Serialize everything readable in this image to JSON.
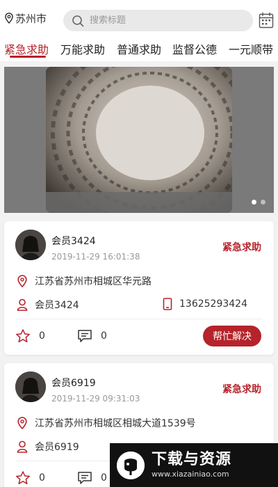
{
  "header": {
    "city": "苏州市",
    "search_placeholder": "搜索标题",
    "icons": {
      "location": "location-icon",
      "search": "search-icon",
      "calendar": "calendar-icon"
    }
  },
  "tabs": [
    {
      "label": "紧急求助",
      "active": true
    },
    {
      "label": "万能求助",
      "active": false
    },
    {
      "label": "普通求助",
      "active": false
    },
    {
      "label": "监督公德",
      "active": false
    },
    {
      "label": "一元顺带",
      "active": false
    }
  ],
  "banner": {
    "pages": 2,
    "current": 1
  },
  "posts": [
    {
      "member": "会员3424",
      "time": "2019-11-29 16:01:38",
      "badge": "紧急求助",
      "address": "江苏省苏州市相城区华元路",
      "contact": "会员3424",
      "phone": "13625293424",
      "likes": "0",
      "comments": "0",
      "action": "帮忙解决"
    },
    {
      "member": "会员6919",
      "time": "2019-11-29 09:31:03",
      "badge": "紧急求助",
      "address": "江苏省苏州市相城区相城大道1539号",
      "contact": "会员6919",
      "likes": "0",
      "comments": "0"
    }
  ],
  "watermark": {
    "title": "下载与资源",
    "url": "www.xiazainiao.com"
  },
  "colors": {
    "accent": "#b5232b",
    "background": "#f2f2f2",
    "muted": "#999999"
  }
}
